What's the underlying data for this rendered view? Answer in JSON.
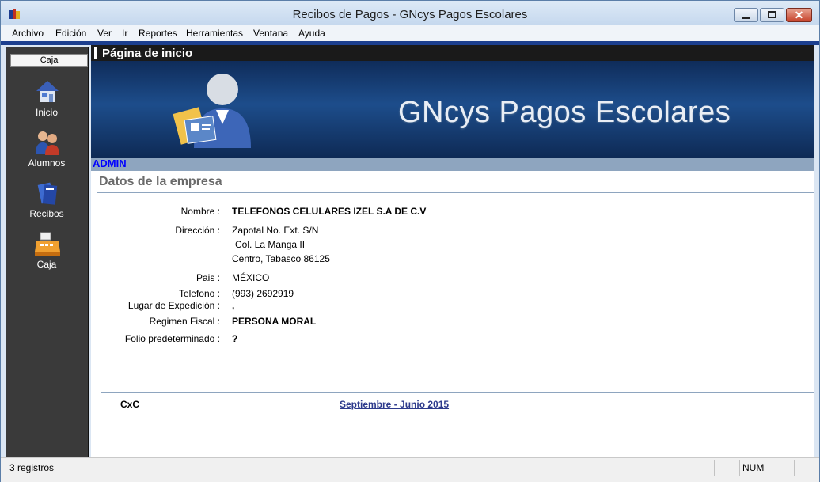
{
  "window": {
    "title": "Recibos de Pagos - GNcys Pagos Escolares"
  },
  "menu": [
    "Archivo",
    "Edición",
    "Ver",
    "Ir",
    "Reportes",
    "Herramientas",
    "Ventana",
    "Ayuda"
  ],
  "sidebar": {
    "header": "Caja",
    "items": [
      {
        "label": "Inicio",
        "icon": "house-icon"
      },
      {
        "label": "Alumnos",
        "icon": "students-icon"
      },
      {
        "label": "Recibos",
        "icon": "receipts-icon"
      },
      {
        "label": "Caja",
        "icon": "cash-register-icon"
      }
    ]
  },
  "page": {
    "title": "Página de inicio",
    "banner_title": "GNcys Pagos Escolares",
    "user": "ADMIN",
    "section_title": "Datos de la empresa"
  },
  "company": {
    "nombre_label": "Nombre :",
    "nombre": "TELEFONOS CELULARES IZEL S.A DE C.V",
    "direccion_label": "Dirección :",
    "direccion_1": "Zapotal No. Ext. S/N",
    "direccion_2": "Col. La Manga II",
    "direccion_3": "Centro, Tabasco 86125",
    "pais_label": "Pais :",
    "pais": "MÉXICO",
    "telefono_label": "Telefono :",
    "telefono": "(993) 2692919",
    "lugar_label": "Lugar de Expedición :",
    "lugar": ",",
    "regimen_label": "Regimen Fiscal :",
    "regimen": "PERSONA MORAL",
    "folio_label": "Folio predeterminado :",
    "folio": "?"
  },
  "footer": {
    "left": "CxC",
    "period": "Septiembre - Junio 2015"
  },
  "status": {
    "records": "3 registros",
    "num": "NUM"
  },
  "colors": {
    "accent": "#1c3f8f",
    "sidebar": "#3a3a3a",
    "banner": "#1d4d8b",
    "link": "#2d3a8c"
  }
}
